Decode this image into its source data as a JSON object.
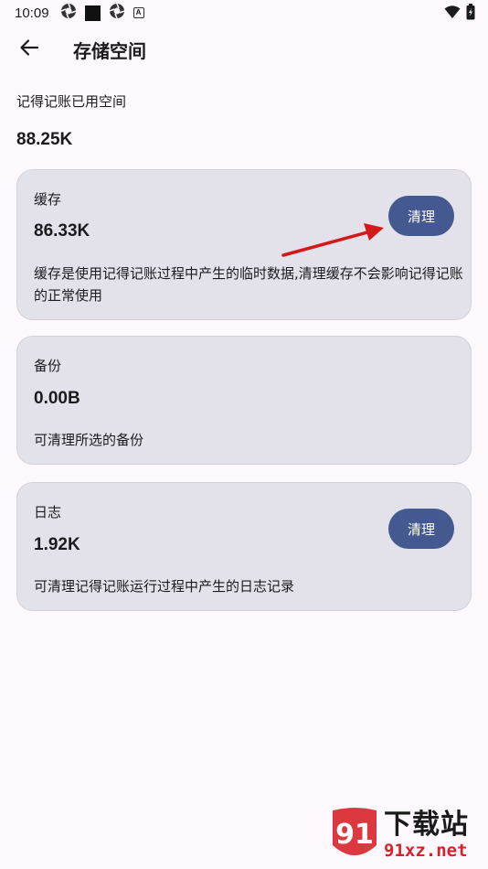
{
  "status_bar": {
    "time": "10:09",
    "icons_left": [
      "aperture-icon",
      "black-square-icon",
      "aperture-icon",
      "a-badge-icon"
    ],
    "icons_right": [
      "wifi-icon",
      "battery-icon"
    ],
    "a_badge": "A"
  },
  "header": {
    "title": "存储空间"
  },
  "summary": {
    "label": "记得记账已用空间",
    "value": "88.25K"
  },
  "cards": [
    {
      "title": "缓存",
      "value": "86.33K",
      "description": "缓存是使用记得记账过程中产生的临时数据,清理缓存不会影响记得记账的正常使用",
      "button_label": "清理"
    },
    {
      "title": "备份",
      "value": "0.00B",
      "description": "可清理所选的备份"
    },
    {
      "title": "日志",
      "value": "1.92K",
      "description": "可清理记得记账运行过程中产生的日志记录",
      "button_label": "清理"
    }
  ],
  "watermark": {
    "main": "下载站",
    "sub": "91xz.net",
    "logo_text": "91"
  },
  "colors": {
    "background": "#fcf8fd",
    "card": "#e3e2ea",
    "button": "#445990",
    "arrow": "#d21a1a"
  }
}
